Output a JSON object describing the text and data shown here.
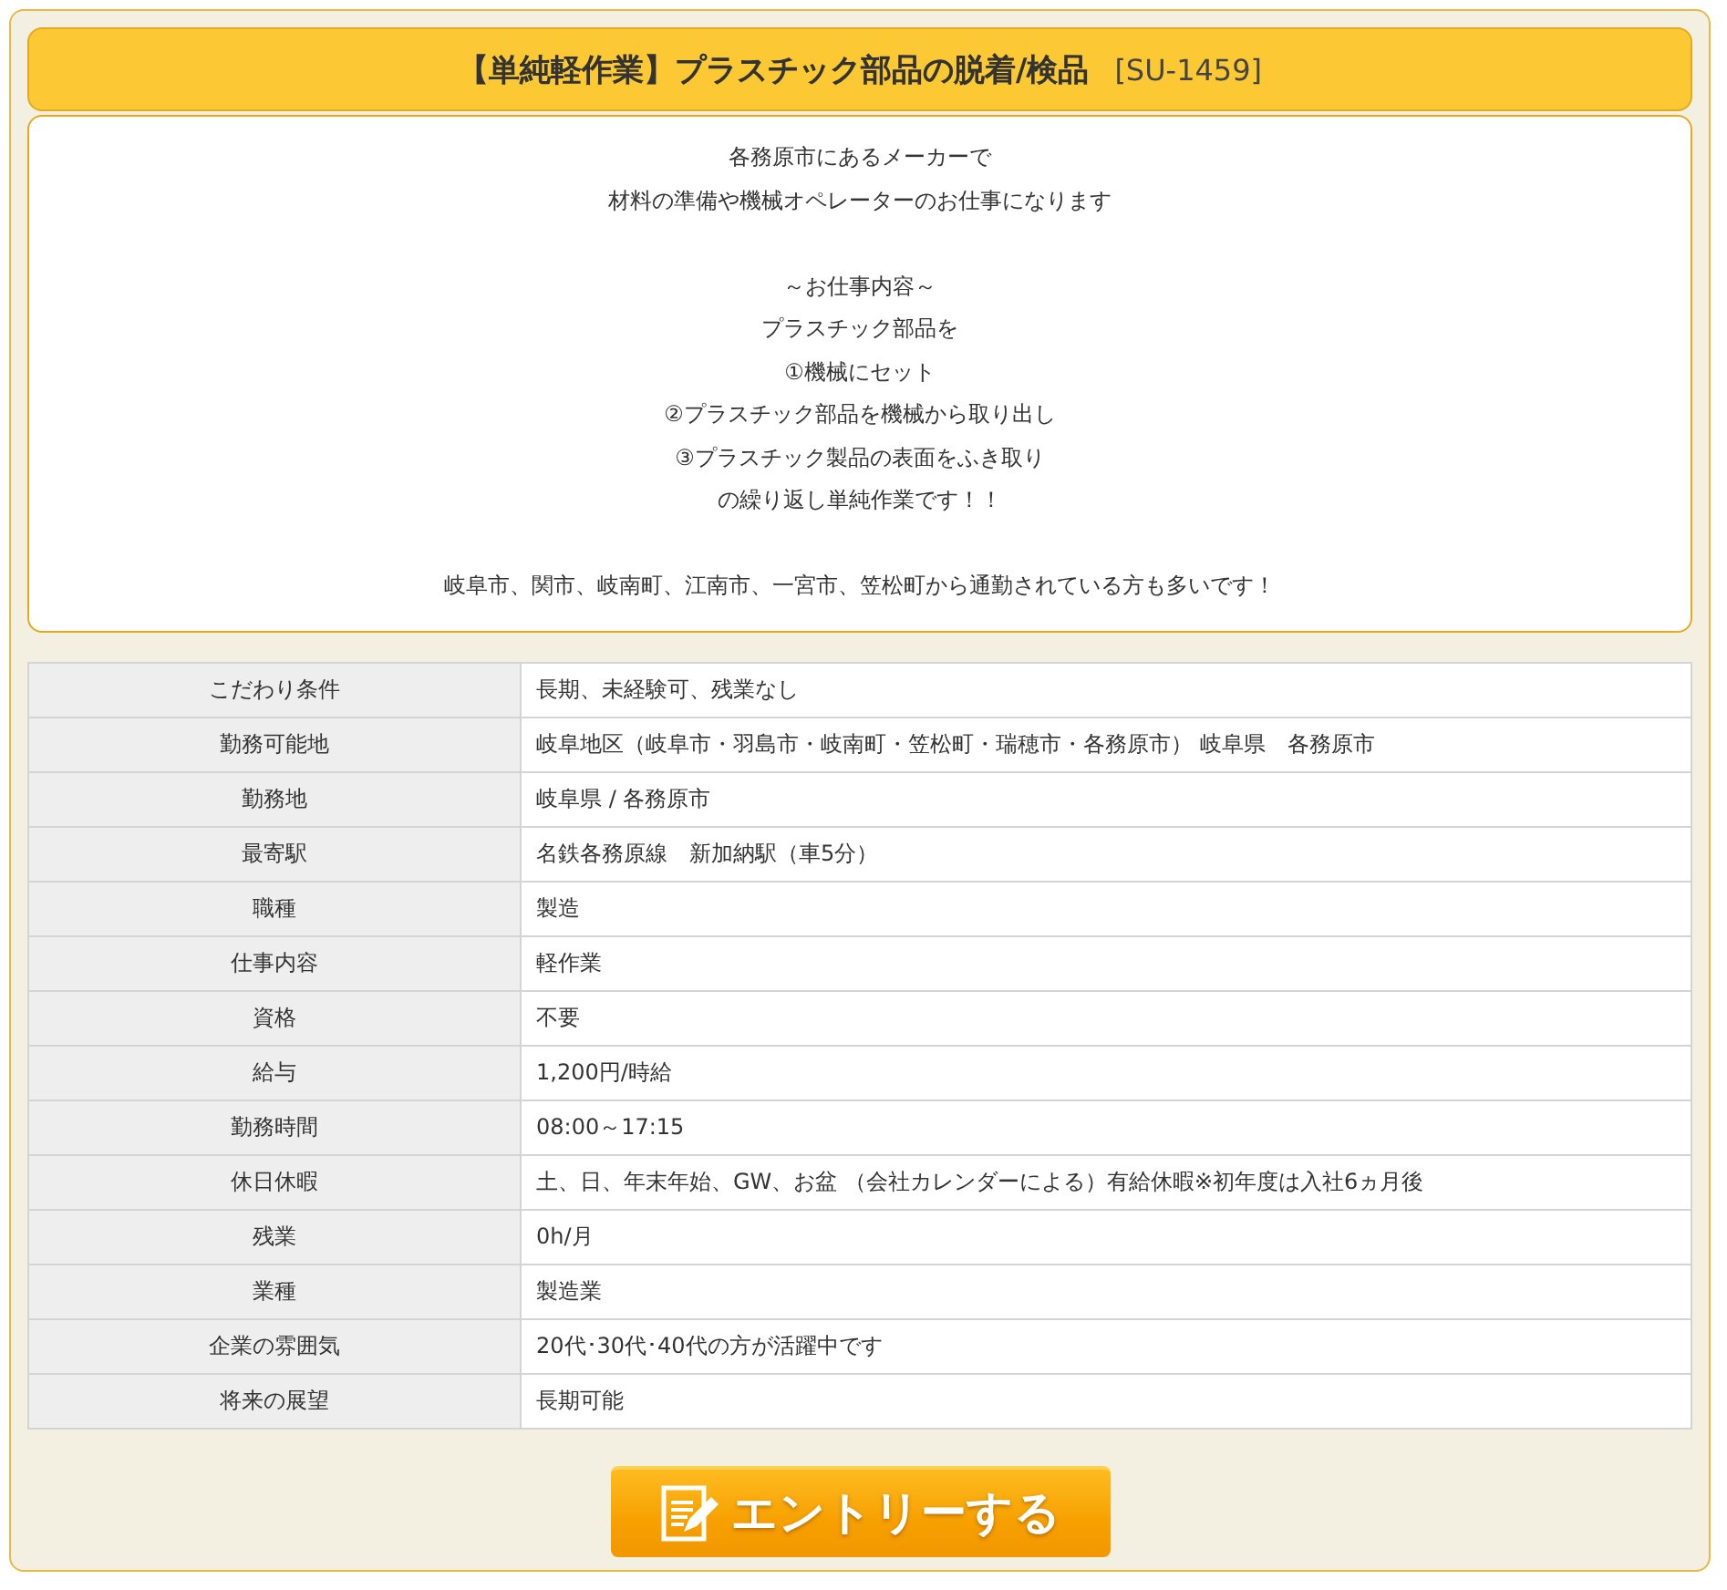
{
  "title": {
    "main": "【単純軽作業】プラスチック部品の脱着/検品",
    "code": "[SU-1459]"
  },
  "description": [
    [
      "各務原市にあるメーカーで",
      "材料の準備や機械オペレーターのお仕事になります"
    ],
    [
      "～お仕事内容～",
      "プラスチック部品を",
      "①機械にセット",
      "②プラスチック部品を機械から取り出し",
      "③プラスチック製品の表面をふき取り",
      "の繰り返し単純作業です！！"
    ],
    [
      "岐阜市、関市、岐南町、江南市、一宮市、笠松町から通勤されている方も多いです！"
    ]
  ],
  "table": {
    "rows": [
      {
        "label": "こだわり条件",
        "value": "長期、未経験可、残業なし"
      },
      {
        "label": "勤務可能地",
        "value": "岐阜地区（岐阜市・羽島市・岐南町・笠松町・瑞穂市・各務原市） 岐阜県　各務原市"
      },
      {
        "label": "勤務地",
        "value": "岐阜県 / 各務原市"
      },
      {
        "label": "最寄駅",
        "value": "名鉄各務原線　新加納駅（車5分）"
      },
      {
        "label": "職種",
        "value": "製造"
      },
      {
        "label": "仕事内容",
        "value": "軽作業"
      },
      {
        "label": "資格",
        "value": "不要"
      },
      {
        "label": "給与",
        "value": "1,200円/時給"
      },
      {
        "label": "勤務時間",
        "value": "08:00～17:15"
      },
      {
        "label": "休日休暇",
        "value": "土、日、年末年始、GW、お盆 （会社カレンダーによる）有給休暇※初年度は入社6ヵ月後"
      },
      {
        "label": "残業",
        "value": "0h/月"
      },
      {
        "label": "業種",
        "value": "製造業"
      },
      {
        "label": "企業の雰囲気",
        "value": "20代･30代･40代の方が活躍中です"
      },
      {
        "label": "将来の展望",
        "value": "長期可能"
      }
    ]
  },
  "entry_button": {
    "label": "エントリーする"
  }
}
